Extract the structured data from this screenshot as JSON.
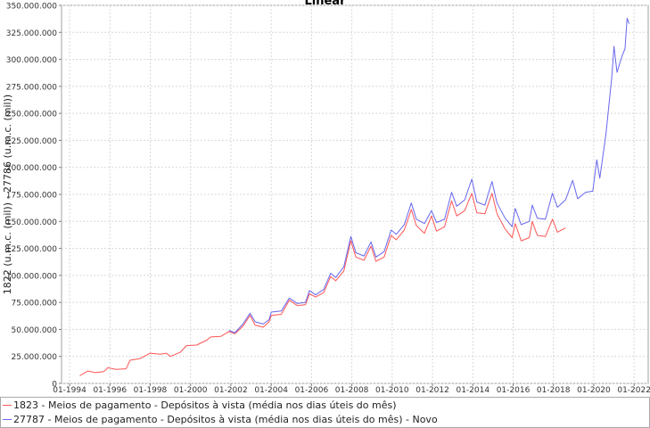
{
  "chart_data": {
    "type": "line",
    "title": "Linear",
    "ylabel": "1822 (u.m.c. (mil)) - 27786 (u.m.c. (mil))",
    "xlabel": "",
    "xlim": [
      1993.6,
      2022.7
    ],
    "ylim": [
      0,
      350000000
    ],
    "grid": true,
    "legend_position": "bottom",
    "y_ticks": [
      0,
      25000000,
      50000000,
      75000000,
      100000000,
      125000000,
      150000000,
      175000000,
      200000000,
      225000000,
      250000000,
      275000000,
      300000000,
      325000000,
      350000000
    ],
    "y_tick_labels": [
      "0",
      "25.000.000",
      "50.000.000",
      "75.000.000",
      "100.000.000",
      "125.000.000",
      "150.000.000",
      "175.000.000",
      "200.000.000",
      "225.000.000",
      "250.000.000",
      "275.000.000",
      "300.000.000",
      "325.000.000",
      "350.000.000"
    ],
    "x_ticks": [
      1994,
      1996,
      1998,
      2000,
      2002,
      2004,
      2006,
      2008,
      2010,
      2012,
      2014,
      2016,
      2018,
      2020,
      2022
    ],
    "x_tick_labels": [
      "01-1994",
      "01-1996",
      "01-1998",
      "01-2000",
      "01-2002",
      "01-2004",
      "01-2006",
      "01-2008",
      "01-2010",
      "01-2012",
      "01-2014",
      "01-2016",
      "01-2018",
      "01-2020",
      "01-2022"
    ],
    "series": [
      {
        "name": "1823 - Meios de pagamento - Depósitos à vista (média nos dias úteis do mês)",
        "color": "#ff5555",
        "points": [
          [
            1994.5,
            7000000
          ],
          [
            1994.9,
            11500000
          ],
          [
            1995.3,
            10000000
          ],
          [
            1995.7,
            11000000
          ],
          [
            1995.9,
            14500000
          ],
          [
            1996.3,
            13000000
          ],
          [
            1996.8,
            13500000
          ],
          [
            1997.0,
            21500000
          ],
          [
            1997.5,
            23000000
          ],
          [
            1998.0,
            28000000
          ],
          [
            1998.5,
            27000000
          ],
          [
            1998.8,
            28000000
          ],
          [
            1999.0,
            25000000
          ],
          [
            1999.5,
            29000000
          ],
          [
            1999.8,
            35000000
          ],
          [
            2000.3,
            35500000
          ],
          [
            2000.8,
            40000000
          ],
          [
            2001.0,
            43000000
          ],
          [
            2001.5,
            43500000
          ],
          [
            2001.9,
            48000000
          ],
          [
            2002.2,
            46000000
          ],
          [
            2002.6,
            53000000
          ],
          [
            2002.95,
            63000000
          ],
          [
            2003.2,
            54000000
          ],
          [
            2003.6,
            52000000
          ],
          [
            2003.9,
            57000000
          ],
          [
            2004.0,
            63000000
          ],
          [
            2004.5,
            64000000
          ],
          [
            2004.9,
            77000000
          ],
          [
            2005.3,
            72000000
          ],
          [
            2005.7,
            73000000
          ],
          [
            2005.9,
            83000000
          ],
          [
            2006.2,
            80000000
          ],
          [
            2006.6,
            84000000
          ],
          [
            2006.95,
            99000000
          ],
          [
            2007.2,
            95000000
          ],
          [
            2007.6,
            104000000
          ],
          [
            2007.95,
            132000000
          ],
          [
            2008.2,
            117000000
          ],
          [
            2008.6,
            114000000
          ],
          [
            2008.95,
            127000000
          ],
          [
            2009.2,
            113000000
          ],
          [
            2009.6,
            117000000
          ],
          [
            2009.95,
            137000000
          ],
          [
            2010.2,
            133000000
          ],
          [
            2010.6,
            142000000
          ],
          [
            2010.95,
            161000000
          ],
          [
            2011.2,
            146000000
          ],
          [
            2011.6,
            139000000
          ],
          [
            2011.95,
            155000000
          ],
          [
            2012.2,
            141000000
          ],
          [
            2012.6,
            145000000
          ],
          [
            2012.95,
            169000000
          ],
          [
            2013.2,
            155000000
          ],
          [
            2013.6,
            160000000
          ],
          [
            2013.95,
            176000000
          ],
          [
            2014.2,
            158000000
          ],
          [
            2014.6,
            157000000
          ],
          [
            2014.95,
            176000000
          ],
          [
            2015.2,
            157000000
          ],
          [
            2015.6,
            143000000
          ],
          [
            2015.95,
            135000000
          ],
          [
            2016.1,
            148000000
          ],
          [
            2016.4,
            132000000
          ],
          [
            2016.8,
            135000000
          ],
          [
            2016.95,
            150000000
          ],
          [
            2017.2,
            137000000
          ],
          [
            2017.6,
            136000000
          ],
          [
            2017.95,
            152000000
          ],
          [
            2018.2,
            140000000
          ],
          [
            2018.6,
            144000000
          ]
        ]
      },
      {
        "name": "27787 - Meios de pagamento - Depósitos à vista (média nos dias úteis do mês) - Novo",
        "color": "#6666ee",
        "points": [
          [
            2001.9,
            49000000
          ],
          [
            2002.2,
            47000000
          ],
          [
            2002.6,
            55000000
          ],
          [
            2002.95,
            65000000
          ],
          [
            2003.2,
            57000000
          ],
          [
            2003.6,
            55000000
          ],
          [
            2003.9,
            59000000
          ],
          [
            2004.0,
            66000000
          ],
          [
            2004.5,
            67000000
          ],
          [
            2004.9,
            79000000
          ],
          [
            2005.3,
            74000000
          ],
          [
            2005.7,
            75000000
          ],
          [
            2005.9,
            86000000
          ],
          [
            2006.2,
            82000000
          ],
          [
            2006.6,
            87000000
          ],
          [
            2006.95,
            102000000
          ],
          [
            2007.2,
            98000000
          ],
          [
            2007.6,
            108000000
          ],
          [
            2007.95,
            136000000
          ],
          [
            2008.2,
            121000000
          ],
          [
            2008.6,
            118000000
          ],
          [
            2008.95,
            131000000
          ],
          [
            2009.2,
            117000000
          ],
          [
            2009.6,
            122000000
          ],
          [
            2009.95,
            142000000
          ],
          [
            2010.2,
            138000000
          ],
          [
            2010.6,
            147000000
          ],
          [
            2010.95,
            167000000
          ],
          [
            2011.2,
            152000000
          ],
          [
            2011.6,
            148000000
          ],
          [
            2011.95,
            160000000
          ],
          [
            2012.2,
            149000000
          ],
          [
            2012.6,
            152000000
          ],
          [
            2012.95,
            177000000
          ],
          [
            2013.2,
            164000000
          ],
          [
            2013.6,
            170000000
          ],
          [
            2013.95,
            189000000
          ],
          [
            2014.2,
            168000000
          ],
          [
            2014.6,
            165000000
          ],
          [
            2014.95,
            187000000
          ],
          [
            2015.2,
            167000000
          ],
          [
            2015.6,
            153000000
          ],
          [
            2015.95,
            145000000
          ],
          [
            2016.1,
            162000000
          ],
          [
            2016.4,
            147000000
          ],
          [
            2016.8,
            150000000
          ],
          [
            2016.95,
            165000000
          ],
          [
            2017.2,
            153000000
          ],
          [
            2017.6,
            152000000
          ],
          [
            2017.95,
            176000000
          ],
          [
            2018.2,
            163000000
          ],
          [
            2018.6,
            170000000
          ],
          [
            2018.95,
            188000000
          ],
          [
            2019.2,
            171000000
          ],
          [
            2019.6,
            177000000
          ],
          [
            2019.95,
            178000000
          ],
          [
            2020.15,
            207000000
          ],
          [
            2020.3,
            190000000
          ],
          [
            2020.6,
            230000000
          ],
          [
            2020.9,
            285000000
          ],
          [
            2021.0,
            312000000
          ],
          [
            2021.15,
            288000000
          ],
          [
            2021.4,
            303000000
          ],
          [
            2021.55,
            310000000
          ],
          [
            2021.65,
            338000000
          ],
          [
            2021.75,
            333000000
          ]
        ]
      }
    ]
  }
}
